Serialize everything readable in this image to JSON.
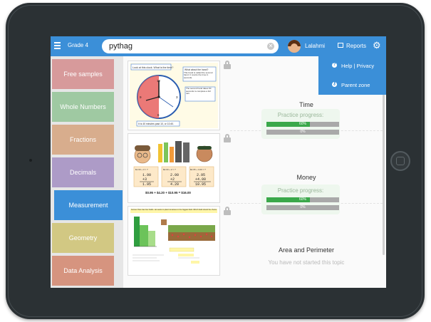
{
  "topbar": {
    "grade_label": "Grade 4",
    "search_value": "pythag",
    "user_name": "Lalahmi",
    "reports_label": "Reports"
  },
  "sidebar": {
    "items": [
      {
        "label": "Free samples",
        "color": "#d79a9b"
      },
      {
        "label": "Whole Numbers",
        "color": "#9fc9a2"
      },
      {
        "label": "Fractions",
        "color": "#d8ad8d"
      },
      {
        "label": "Decimals",
        "color": "#ad9bc7"
      },
      {
        "label": "Measurement",
        "color": "#3b8fd8"
      },
      {
        "label": "Geometry",
        "color": "#d2c883"
      },
      {
        "label": "Data Analysis",
        "color": "#d6947f"
      }
    ],
    "active_index": 4
  },
  "menu": {
    "help_label": "Help | Privacy",
    "parent_label": "Parent zone"
  },
  "topics": [
    {
      "title": "Time",
      "progress_label": "Practice progress:",
      "bars": [
        {
          "text": "60%",
          "fraction": 0.6
        },
        {
          "text": "0%",
          "fraction": 0.0
        }
      ]
    },
    {
      "title": "Money",
      "progress_label": "Practice progress:",
      "bars": [
        {
          "text": "60%",
          "fraction": 0.6
        },
        {
          "text": "0%",
          "fraction": 0.0
        }
      ]
    },
    {
      "title": "Area and Perimeter",
      "status": "You have not started this topic"
    }
  ],
  "thumbnails": {
    "time": {
      "question": "Look at this clock. What is the time?",
      "note1": "What about the hand?",
      "note2": "This hand is called the second hand. It counts the time in seconds.",
      "note3": "The second hand takes 60 seconds to complete a full turn.",
      "answer": "It is 40 minutes past 10, or 10:40."
    },
    "money": {
      "sums": [
        {
          "head": "$1.90 + 3 = ?",
          "a": "1.90",
          "b": "+3",
          "r": "1.95"
        },
        {
          "head": "$2.00 + 2 = ?",
          "a": "2.00",
          "b": "+2",
          "r": "4.20"
        },
        {
          "head": "$2.95 + 4.00 = ?",
          "a": "2.95",
          "b": "+4.00",
          "r": "10.95"
        }
      ],
      "total": "$0.95 + $4.20 + $10.95 = $16.00"
    },
    "area": {
      "instruction": "Farmer Pete has four fields. He wants to plant tomatoes in the biggest field. Which field should he choose?"
    }
  },
  "colors": {
    "accent": "#3b8fd8",
    "progress_fill": "#3aa84a",
    "progress_empty": "#a9a9a9"
  }
}
